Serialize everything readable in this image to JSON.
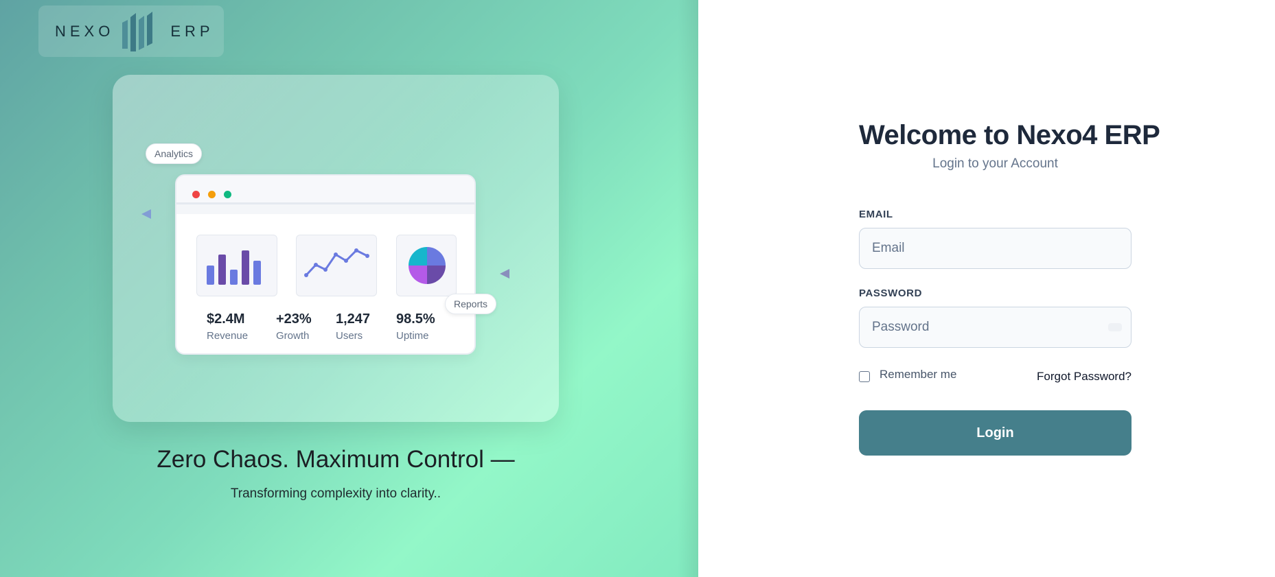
{
  "brand": {
    "logo_left": "NEXO",
    "logo_right": "ERP",
    "logo_mark_icon": "bar-chart-logo-icon"
  },
  "hero": {
    "tag_analytics": "Analytics",
    "tag_reports": "Reports",
    "window_controls": [
      "red-dot",
      "yellow-dot",
      "green-dot"
    ],
    "mini_charts": [
      "bar-chart-icon",
      "line-chart-icon",
      "pie-chart-icon"
    ],
    "stats": [
      {
        "value": "$2.4M",
        "label": "Revenue"
      },
      {
        "value": "+23%",
        "label": "Growth"
      },
      {
        "value": "1,247",
        "label": "Users"
      },
      {
        "value": "98.5%",
        "label": "Uptime"
      }
    ],
    "tagline": "Zero Chaos. Maximum Control —",
    "subtagline": "Transforming complexity into clarity.."
  },
  "login": {
    "title": "Welcome to Nexo4 ERP",
    "subtitle": "Login to your Account",
    "email_label": "EMAIL",
    "email_placeholder": "Email",
    "password_label": "PASSWORD",
    "password_placeholder": "Password",
    "remember_label": "Remember me",
    "remember_checked": false,
    "forgot_label": "Forgot Password?",
    "submit_label": "Login"
  },
  "colors": {
    "primary_button": "#457f8b",
    "title_text": "#1e293b",
    "gradient_start": "#5fa3a3",
    "gradient_end": "#93f7c8"
  }
}
